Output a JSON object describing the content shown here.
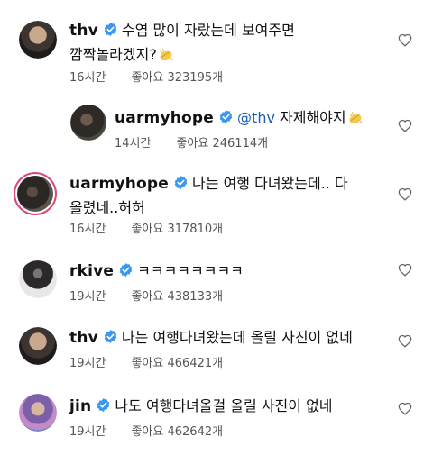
{
  "comments": [
    {
      "username": "thv",
      "text_line1": "수염 많이 자랐는데 보여주면",
      "text_line2": "깜짝놀라겠지?",
      "emoji": "clapping-hands",
      "time": "16시간",
      "likes": "좋아요 323195개"
    },
    {
      "username": "uarmyhope",
      "mention": "@thv",
      "text_line1": " 자제해야지",
      "emoji": "clapping-hands",
      "time": "14시간",
      "likes": "좋아요 246114개",
      "is_reply": true
    },
    {
      "username": "uarmyhope",
      "text_line1": "나는 여행 다녀왔는데.. 다",
      "text_line2": "올렸네..허허",
      "time": "16시간",
      "likes": "좋아요 317810개"
    },
    {
      "username": "rkive",
      "text_line1": "ㅋㅋㅋㅋㅋㅋㅋㅋ",
      "time": "19시간",
      "likes": "좋아요 438133개"
    },
    {
      "username": "thv",
      "text_line1": "나는 여행다녀왔는데 올릴 사진이 없네",
      "time": "19시간",
      "likes": "좋아요 466421개"
    },
    {
      "username": "jin",
      "text_line1": "나도 여행다녀올걸 올릴 사진이 없네",
      "time": "19시간",
      "likes": "좋아요 462642개"
    }
  ],
  "colors": {
    "verified": "#3897f0",
    "story_ring": "#d6497a",
    "meta_text": "#555555",
    "mention": "#1a5fb4"
  },
  "icons": {
    "like": "heart-outline-icon",
    "verified": "verified-badge-icon",
    "emoji": "clapping-hands-emoji"
  }
}
